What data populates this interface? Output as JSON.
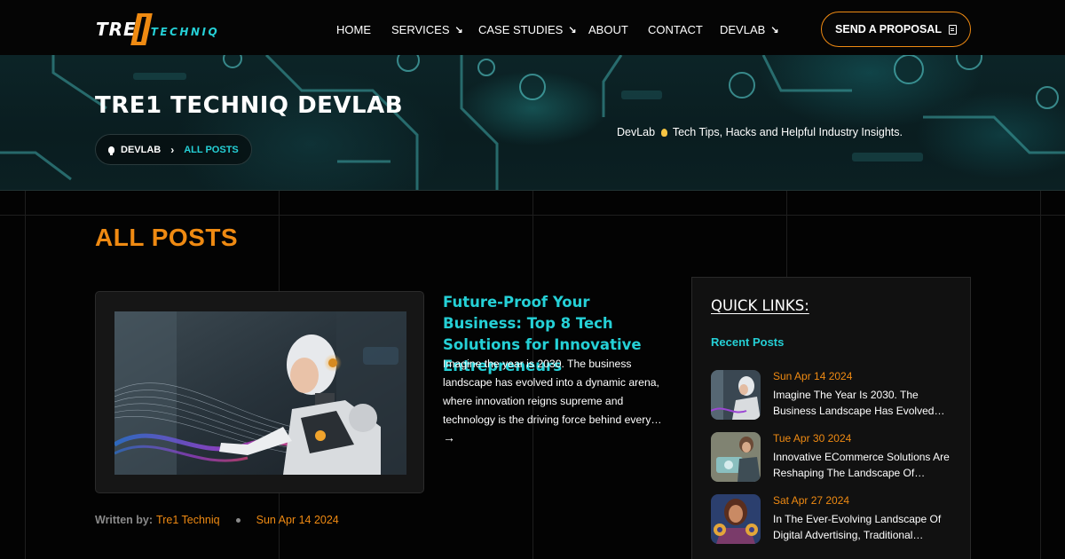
{
  "brand": {
    "logo_tre": "TRE",
    "logo_techniq": "TECHNIQ"
  },
  "nav": {
    "items": [
      {
        "label": "HOME",
        "has_arrow": false
      },
      {
        "label": "SERVICES",
        "has_arrow": true
      },
      {
        "label": "CASE STUDIES",
        "has_arrow": true
      },
      {
        "label": "ABOUT",
        "has_arrow": false
      },
      {
        "label": "CONTACT",
        "has_arrow": false
      },
      {
        "label": "DEVLAB",
        "has_arrow": true
      }
    ],
    "arrow_glyph": "↘",
    "cta_label": "SEND A PROPOSAL"
  },
  "hero": {
    "title": "TRE1 TECHNIQ DEVLAB",
    "breadcrumb": {
      "root": "DEVLAB",
      "separator": "›",
      "current": "ALL POSTS"
    },
    "tagline_prefix": "DevLab",
    "tagline_suffix": "Tech Tips, Hacks and Helpful Industry Insights."
  },
  "main": {
    "section_title": "ALL POSTS",
    "post": {
      "title": "Future-Proof Your Business: Top 8 Tech Solutions for Innovative Entrepreneurs",
      "excerpt": "Imagine the year is 2030. The business landscape has evolved into a dynamic arena, where innovation reigns supreme and technology is the driving force behind every…",
      "read_more_glyph": "→",
      "meta": {
        "written_by_label": "Written by:",
        "author": "Tre1 Techniq",
        "date": "Sun Apr 14 2024"
      }
    }
  },
  "sidebar": {
    "title": "QUICK LINKS:",
    "recent_title": "Recent Posts",
    "recent_posts": [
      {
        "date": "Sun Apr 14 2024",
        "text": "Imagine The Year Is 2030. The Business Landscape Has Evolved…"
      },
      {
        "date": "Tue Apr 30 2024",
        "text": "Innovative ECommerce Solutions Are Reshaping The Landscape Of…"
      },
      {
        "date": "Sat Apr 27 2024",
        "text": "In The Ever-Evolving Landscape Of Digital Advertising, Traditional…"
      }
    ]
  },
  "colors": {
    "accent_orange": "#ef8a12",
    "accent_cyan": "#25d0d6",
    "background": "#030303"
  }
}
